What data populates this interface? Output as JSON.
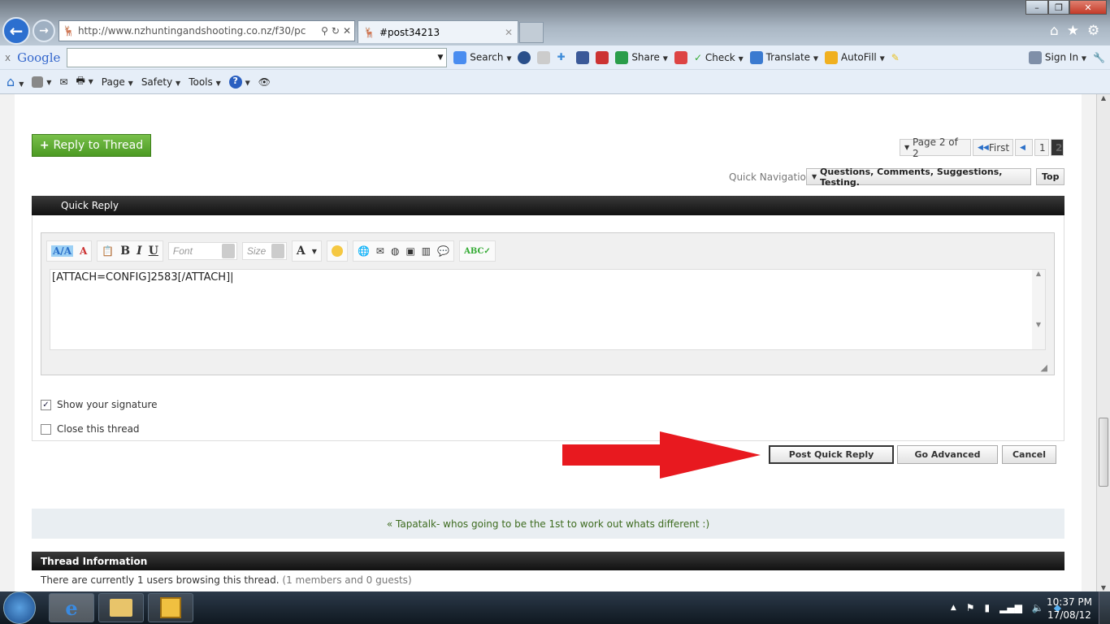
{
  "browser": {
    "url": "http://www.nzhuntingandshooting.co.nz/f30/pc",
    "url_domain": "nzhuntingandshooting.co.nz",
    "tab_title": "#post34213",
    "google_toolbar": {
      "close": "x",
      "logo": "Google",
      "search_label": "Search",
      "share_label": "Share",
      "check_label": "Check",
      "translate_label": "Translate",
      "autofill_label": "AutoFill",
      "signin_label": "Sign In"
    },
    "command_bar": {
      "page_label": "Page",
      "safety_label": "Safety",
      "tools_label": "Tools"
    }
  },
  "thread": {
    "reply_button": "Reply to Thread",
    "pagination": {
      "page_label": "Page 2 of 2",
      "first_label": "First",
      "pages": [
        "1",
        "2"
      ],
      "current": "2"
    },
    "quick_nav_label": "Quick Navigation",
    "quick_nav_value": "Questions, Comments, Suggestions, Testing.",
    "top_label": "Top"
  },
  "quick_reply": {
    "title": "Quick Reply",
    "font_placeholder": "Font",
    "size_placeholder": "Size",
    "text": "[ATTACH=CONFIG]2583[/ATTACH]",
    "show_signature_label": "Show your signature",
    "show_signature_checked": true,
    "close_thread_label": "Close this thread",
    "close_thread_checked": false,
    "post_button": "Post Quick Reply",
    "advanced_button": "Go Advanced",
    "cancel_button": "Cancel"
  },
  "annotation_arrow_color": "#e8191f",
  "prev_thread": "« Tapatalk- whos going to be the 1st to work out whats different :)",
  "thread_info": {
    "title": "Thread Information",
    "text": "There are currently 1 users browsing this thread.",
    "detail": "(1 members and 0 guests)"
  },
  "taskbar": {
    "time": "10:37 PM",
    "date": "17/08/12"
  }
}
